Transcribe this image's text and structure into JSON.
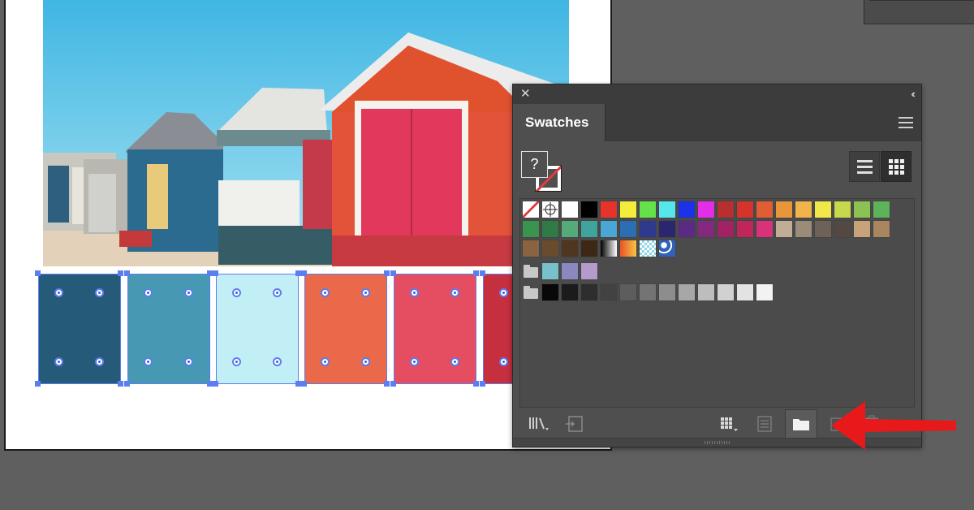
{
  "panel": {
    "title": "Swatches",
    "close_glyph": "✕",
    "collapse_glyph": "‹‹",
    "fill_unknown_glyph": "?",
    "view_modes": [
      "list-view",
      "grid-view"
    ],
    "active_view": "grid-view"
  },
  "artboard_swatches": [
    "#265a79",
    "#4798b2",
    "#c2eff6",
    "#e9694a",
    "#e44e60",
    "#c62f3e"
  ],
  "swatch_rows": [
    [
      "none",
      "registration",
      "#ffffff",
      "#000000",
      "#e8332a",
      "#f4ec3a",
      "#65e249",
      "#55e7ec",
      "#1b32e9",
      "#e32de6",
      "#b7302f",
      "#d7332d",
      "#e15e35",
      "#e9963b",
      "#f0b44a",
      "#f0e84a",
      "#c6d84b",
      "#8cc253",
      "#5cb35a"
    ],
    [
      "#3b9350",
      "#2f7a46",
      "#55aa7a",
      "#3fa59c",
      "#4ba6d8",
      "#2b6eb4",
      "#2e3a8e",
      "#2c2570",
      "#5b2a84",
      "#84297e",
      "#a22264",
      "#c0265a",
      "#d9317a",
      "#c0ad94",
      "#9b8c7a",
      "#6e6258",
      "#544842",
      "#c8a37a",
      "#a98660"
    ],
    [
      "#8a6440",
      "#6b4b2e",
      "#4e3620",
      "#3d2815",
      "gradient-bw",
      "gradient-orange",
      "pattern-checker",
      "pattern-blue"
    ],
    [
      "folder",
      "#78c1c8",
      "#8b88c0",
      "#b59bcc"
    ],
    [
      "folder",
      "#080808",
      "#1b1b1b",
      "#2e2e2e",
      "#424242",
      "#5d5d5d",
      "#747474",
      "#8d8d8d",
      "#a7a7a7",
      "#bdbdbd",
      "#d1d1d1",
      "#e3e3e3",
      "#f2f2f2"
    ]
  ],
  "bottom_bar": {
    "buttons": [
      "swatch-libraries-menu",
      "place-swatches",
      "show-swatch-kinds",
      "swatch-options",
      "new-color-group",
      "new-swatch",
      "delete-swatch"
    ]
  },
  "annotation": {
    "arrow_color": "#e8191b"
  }
}
